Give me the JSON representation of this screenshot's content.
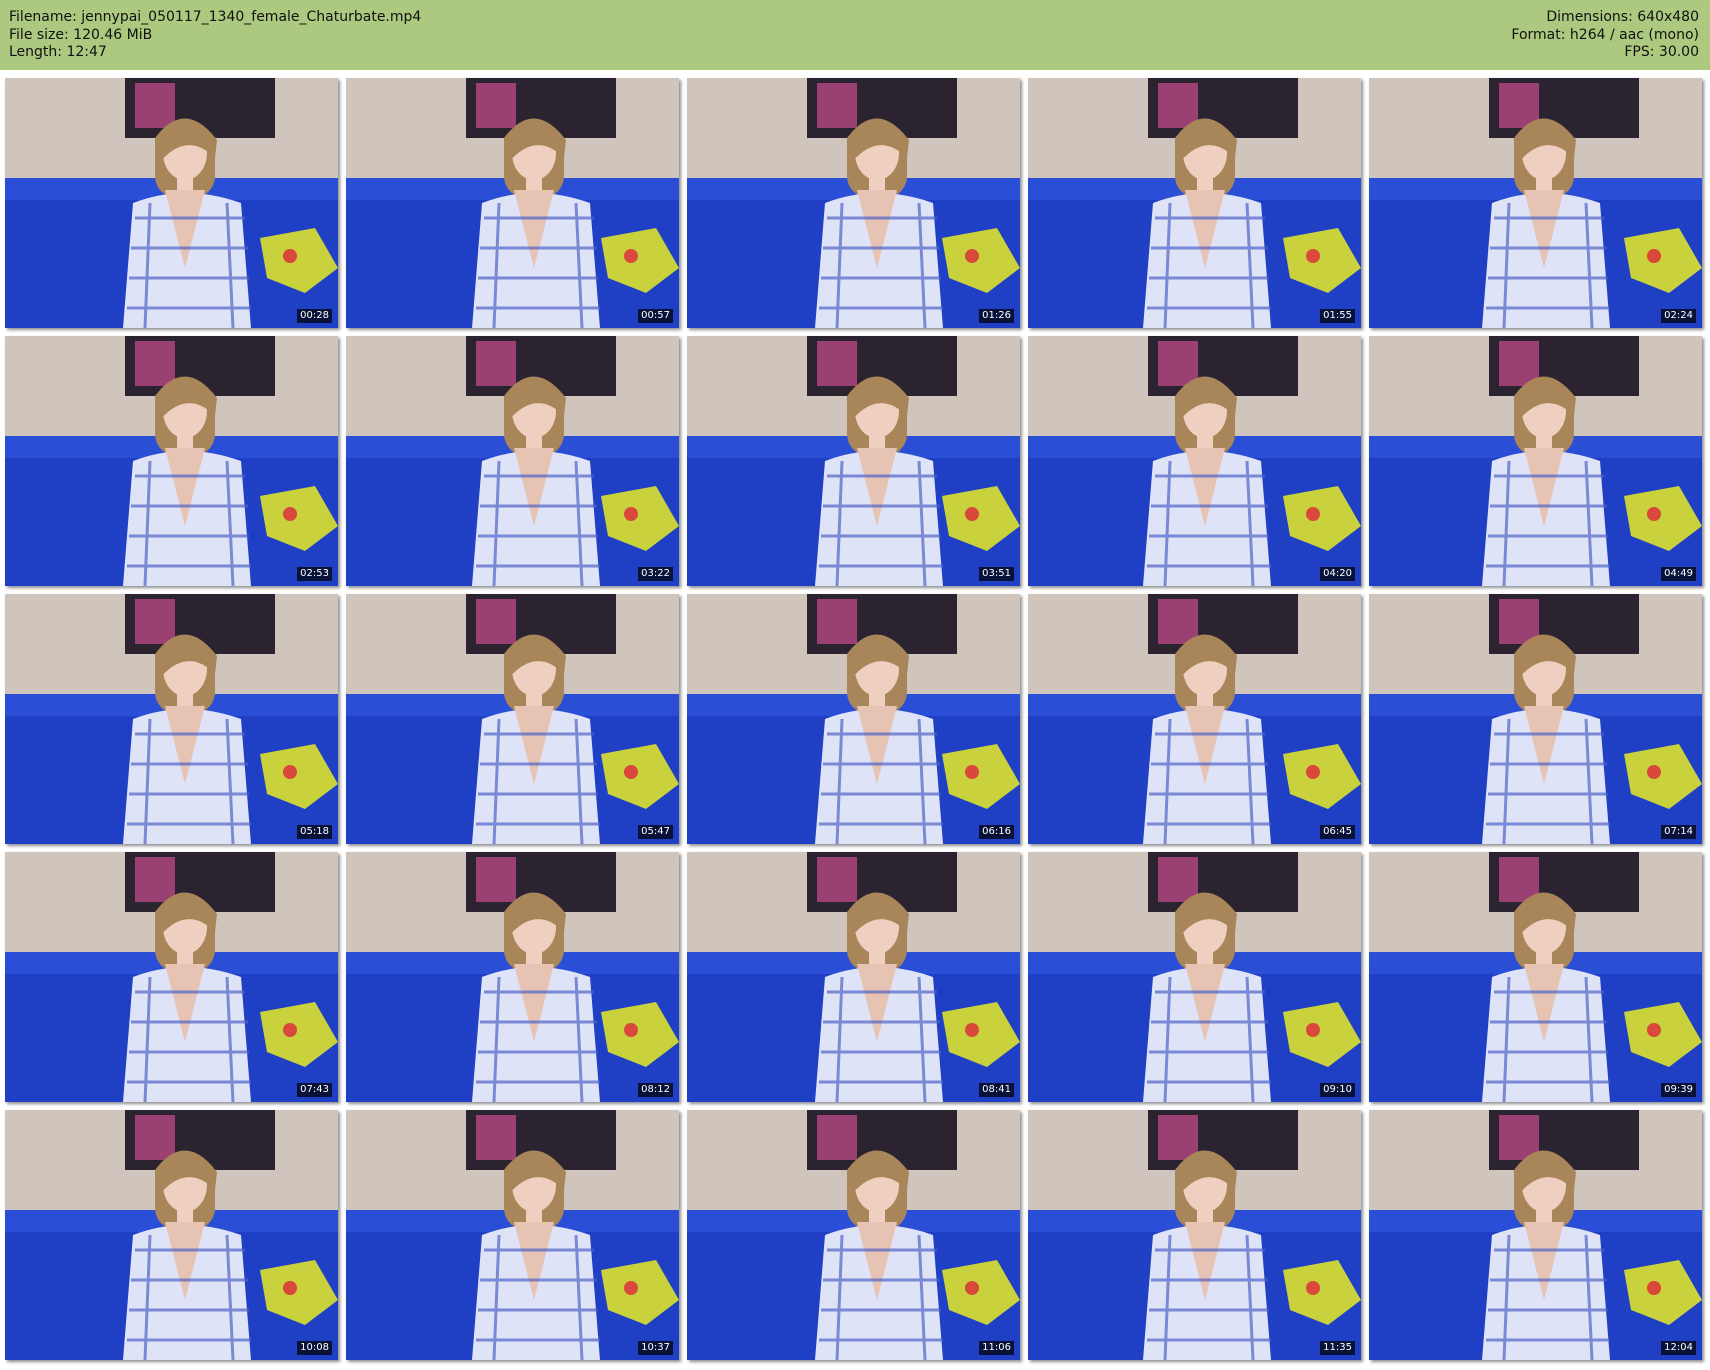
{
  "header": {
    "filename": "Filename: jennypai_050117_1340_female_Chaturbate.mp4",
    "filesize": "File size: 120.46 MiB",
    "length": "Length: 12:47",
    "dimensions": "Dimensions: 640x480",
    "format": "Format: h264 / aac (mono)",
    "fps": "FPS: 30.00"
  },
  "thumbnails": [
    "00:28",
    "00:57",
    "01:26",
    "01:55",
    "02:24",
    "02:53",
    "03:22",
    "03:51",
    "04:20",
    "04:49",
    "05:18",
    "05:47",
    "06:16",
    "06:45",
    "07:14",
    "07:43",
    "08:12",
    "08:41",
    "09:10",
    "09:39",
    "10:08",
    "10:37",
    "11:06",
    "11:35",
    "12:04"
  ],
  "colors": {
    "header_bg": "#adc97f",
    "wall": "#cfc5bc",
    "sofa": "#1f3fc4",
    "shirt": "#dfe3f7",
    "hair": "#a98659",
    "pillow": "#c9d23c"
  }
}
